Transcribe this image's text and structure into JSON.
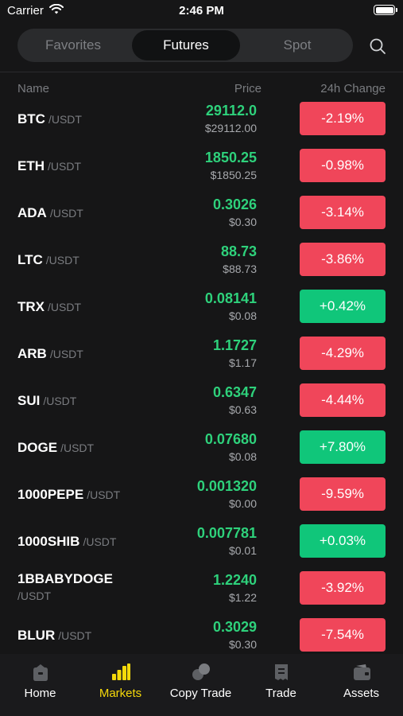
{
  "status": {
    "carrier": "Carrier",
    "time": "2:46 PM"
  },
  "tabs": [
    "Favorites",
    "Futures",
    "Spot"
  ],
  "active_tab": "Futures",
  "columns": {
    "name": "Name",
    "price": "Price",
    "change": "24h Change"
  },
  "rows": [
    {
      "symbol": "BTC",
      "quote": "/USDT",
      "price": "29112.0",
      "usd": "$29112.00",
      "change": "-2.19%",
      "dir": "down"
    },
    {
      "symbol": "ETH",
      "quote": "/USDT",
      "price": "1850.25",
      "usd": "$1850.25",
      "change": "-0.98%",
      "dir": "down"
    },
    {
      "symbol": "ADA",
      "quote": "/USDT",
      "price": "0.3026",
      "usd": "$0.30",
      "change": "-3.14%",
      "dir": "down"
    },
    {
      "symbol": "LTC",
      "quote": "/USDT",
      "price": "88.73",
      "usd": "$88.73",
      "change": "-3.86%",
      "dir": "down"
    },
    {
      "symbol": "TRX",
      "quote": "/USDT",
      "price": "0.08141",
      "usd": "$0.08",
      "change": "+0.42%",
      "dir": "up"
    },
    {
      "symbol": "ARB",
      "quote": "/USDT",
      "price": "1.1727",
      "usd": "$1.17",
      "change": "-4.29%",
      "dir": "down"
    },
    {
      "symbol": "SUI",
      "quote": "/USDT",
      "price": "0.6347",
      "usd": "$0.63",
      "change": "-4.44%",
      "dir": "down"
    },
    {
      "symbol": "DOGE",
      "quote": "/USDT",
      "price": "0.07680",
      "usd": "$0.08",
      "change": "+7.80%",
      "dir": "up"
    },
    {
      "symbol": "1000PEPE",
      "quote": "/USDT",
      "price": "0.001320",
      "usd": "$0.00",
      "change": "-9.59%",
      "dir": "down"
    },
    {
      "symbol": "1000SHIB",
      "quote": "/USDT",
      "price": "0.007781",
      "usd": "$0.01",
      "change": "+0.03%",
      "dir": "up"
    },
    {
      "symbol": "1BBABYDOGE",
      "quote": "/USDT",
      "price": "1.2240",
      "usd": "$1.22",
      "change": "-3.92%",
      "dir": "down"
    },
    {
      "symbol": "BLUR",
      "quote": "/USDT",
      "price": "0.3029",
      "usd": "$0.30",
      "change": "-7.54%",
      "dir": "down"
    }
  ],
  "nav": [
    {
      "label": "Home",
      "icon": "home-icon"
    },
    {
      "label": "Markets",
      "icon": "markets-icon"
    },
    {
      "label": "Copy Trade",
      "icon": "copy-trade-icon"
    },
    {
      "label": "Trade",
      "icon": "trade-icon"
    },
    {
      "label": "Assets",
      "icon": "wallet-icon"
    }
  ],
  "active_nav": "Markets",
  "colors": {
    "up": "#10c67a",
    "down": "#f0465a",
    "price": "#2ed17b",
    "accent": "#f5d90a",
    "background": "#161617"
  }
}
